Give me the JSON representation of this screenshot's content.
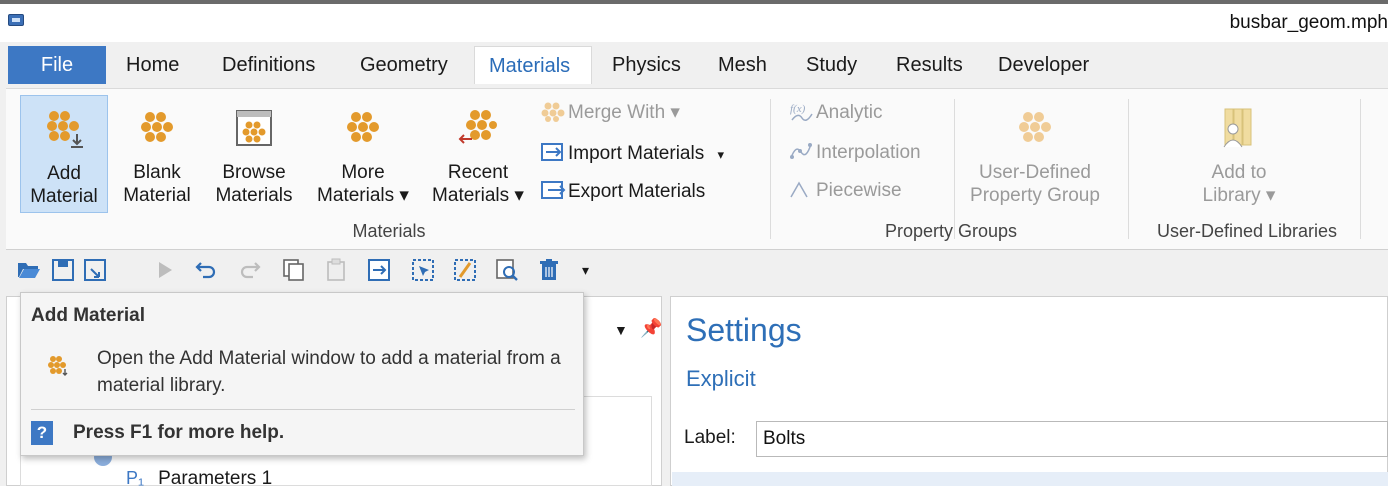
{
  "window": {
    "title": "busbar_geom.mph"
  },
  "tabs": [
    {
      "label": "File"
    },
    {
      "label": "Home"
    },
    {
      "label": "Definitions"
    },
    {
      "label": "Geometry"
    },
    {
      "label": "Materials"
    },
    {
      "label": "Physics"
    },
    {
      "label": "Mesh"
    },
    {
      "label": "Study"
    },
    {
      "label": "Results"
    },
    {
      "label": "Developer"
    }
  ],
  "active_tab": "Materials",
  "ribbon": {
    "materials_group": {
      "label": "Materials",
      "add_material": [
        "Add",
        "Material"
      ],
      "blank_material": [
        "Blank",
        "Material"
      ],
      "browse_materials": [
        "Browse",
        "Materials"
      ],
      "more_materials": [
        "More",
        "Materials ▾"
      ],
      "recent_materials": [
        "Recent",
        "Materials ▾"
      ],
      "merge_with": "Merge With ▾",
      "import_materials": "Import Materials",
      "import_dropdown": "▾",
      "export_materials": "Export Materials"
    },
    "property_groups": {
      "label": "Property Groups",
      "analytic": "Analytic",
      "interpolation": "Interpolation",
      "piecewise": "Piecewise",
      "user_defined_property_group": [
        "User-Defined",
        "Property Group"
      ]
    },
    "user_defined_libraries": {
      "label": "User-Defined Libraries",
      "add_to_library": [
        "Add to",
        "Library ▾"
      ]
    }
  },
  "quick_access": {
    "icons": [
      "open-icon",
      "save-icon",
      "save-as-icon",
      "run-icon",
      "undo-icon",
      "redo-icon",
      "copy-icon",
      "paste-icon",
      "duplicate-icon",
      "select-icon",
      "clear-icon",
      "find-icon",
      "delete-icon"
    ],
    "more": "▾"
  },
  "tooltip": {
    "title": "Add Material",
    "description": "Open the Add Material window to add a material from a material library.",
    "help": "Press F1 for more help."
  },
  "model_tree": {
    "visible_item": "Parameters 1",
    "item_icon": "P₁"
  },
  "settings": {
    "title": "Settings",
    "subtitle": "Explicit",
    "label_caption": "Label:",
    "label_value": "Bolts"
  },
  "colors": {
    "accent": "#3d78c4",
    "ribbon_icon": "#e39a2c",
    "selected_bg": "#cde2f7"
  }
}
